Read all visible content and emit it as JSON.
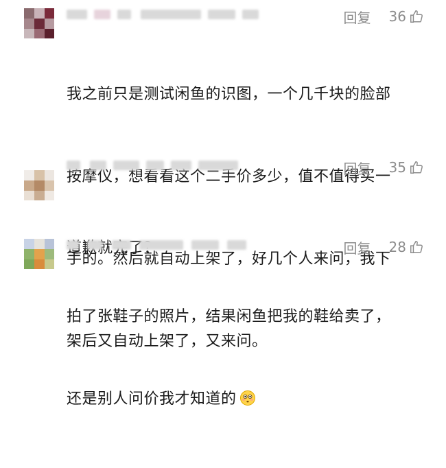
{
  "comments": [
    {
      "reply_label": "回复",
      "likes": "36",
      "lines": [
        "我之前只是测试闲鱼的识图，一个几千块的脸部",
        "按摩仪，想看看这个二手价多少，值不值得买一",
        "手的。然后就自动上架了，好几个人来问，我下",
        "架后又自动上架了，又来问。"
      ]
    },
    {
      "reply_label": "回复",
      "likes": "35",
      "lines": [
        "道歉就完了？"
      ]
    },
    {
      "reply_label": "回复",
      "likes": "28",
      "lines": [
        "拍了张鞋子的照片，结果闲鱼把我的鞋给卖了，",
        "还是别人问价我才知道的"
      ]
    }
  ],
  "icons": {
    "like": "thumbs-up-icon",
    "emoji": "flushed-face-emoji"
  }
}
